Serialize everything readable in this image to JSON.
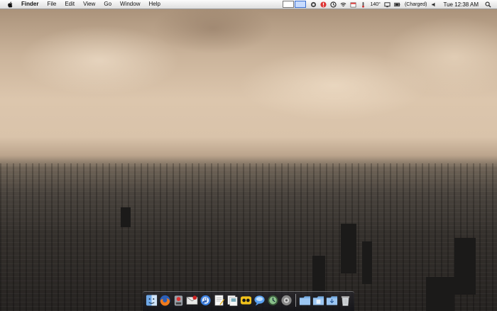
{
  "menubar": {
    "apple_icon": "apple-icon",
    "app_name": "Finder",
    "menus": [
      "File",
      "Edit",
      "View",
      "Go",
      "Window",
      "Help"
    ],
    "status": {
      "temperature": "140°",
      "battery_status": "(Charged)",
      "clock": "Tue 12:38 AM"
    }
  },
  "desktop": {
    "wallpaper": "city-skyline-sepia"
  },
  "dock": {
    "apps": [
      {
        "name": "Finder",
        "icon": "finder-icon"
      },
      {
        "name": "Firefox",
        "icon": "firefox-icon"
      },
      {
        "name": "Transmission",
        "icon": "transmission-icon"
      },
      {
        "name": "Mail",
        "icon": "mail-icon"
      },
      {
        "name": "iTunes",
        "icon": "itunes-icon"
      },
      {
        "name": "TextEdit",
        "icon": "textedit-icon"
      },
      {
        "name": "Preview",
        "icon": "preview-icon"
      },
      {
        "name": "Adium",
        "icon": "adium-icon"
      },
      {
        "name": "iChat",
        "icon": "ichat-icon"
      },
      {
        "name": "Time Machine",
        "icon": "time-machine-icon"
      },
      {
        "name": "System Preferences",
        "icon": "system-preferences-icon"
      }
    ],
    "stacks": [
      {
        "name": "Applications",
        "icon": "folder-icon"
      },
      {
        "name": "Documents",
        "icon": "folder-icon"
      },
      {
        "name": "Downloads",
        "icon": "folder-icon"
      },
      {
        "name": "Trash",
        "icon": "trash-icon"
      }
    ]
  },
  "colors": {
    "menubar_bg": "#f0f0f0",
    "sky": "#d9c3aa",
    "city": "#2a2724"
  }
}
